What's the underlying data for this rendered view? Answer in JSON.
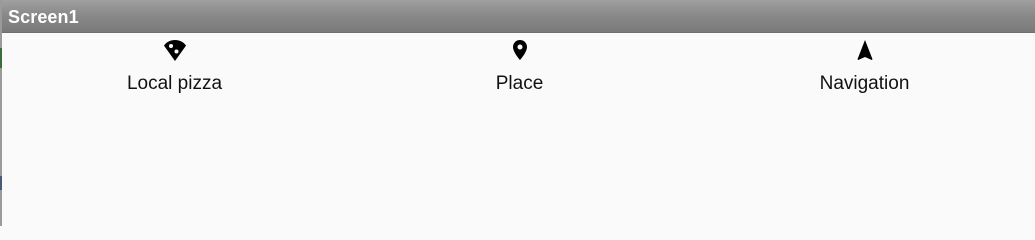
{
  "window": {
    "title": "Screen1"
  },
  "tabs": [
    {
      "label": "Local pizza",
      "icon": "pizza-slice-icon"
    },
    {
      "label": "Place",
      "icon": "map-pin-icon"
    },
    {
      "label": "Navigation",
      "icon": "navigation-arrow-icon"
    }
  ],
  "colors": {
    "titlebar": "#8a8a8a",
    "background": "#fafafa",
    "icon": "#000000",
    "text": "#111111"
  }
}
